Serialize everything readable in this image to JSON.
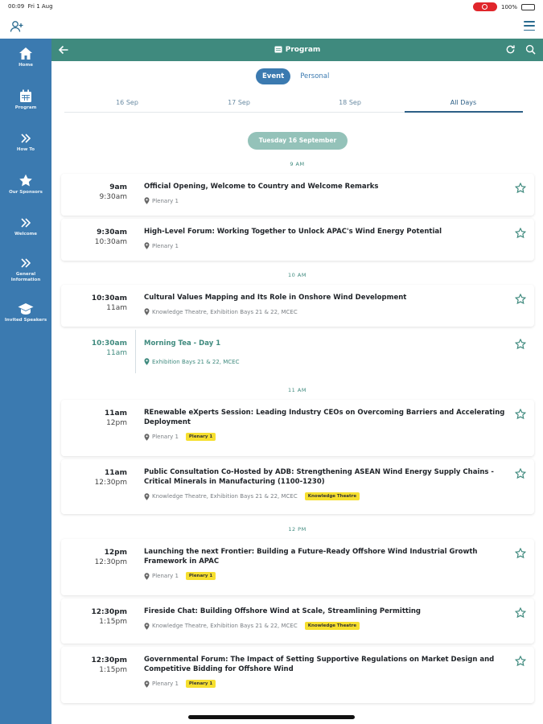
{
  "status": {
    "time": "00:09",
    "date": "Fri 1 Aug",
    "battery": "100%"
  },
  "colors": {
    "sidebar": "#3b7ab0",
    "header": "#3f8a7e",
    "accent": "#3f8a7e",
    "tag": "#f6df2f"
  },
  "sidebar": {
    "items": [
      {
        "label": "Home",
        "icon": "home-icon"
      },
      {
        "label": "Program",
        "icon": "calendar-icon"
      },
      {
        "label": "How To",
        "icon": "chevrons-icon"
      },
      {
        "label": "Our Sponsors",
        "icon": "star-icon"
      },
      {
        "label": "Welcome",
        "icon": "chevrons-icon"
      },
      {
        "label": "General Information",
        "icon": "chevrons-icon"
      },
      {
        "label": "Invited Speakers",
        "icon": "graduation-cap-icon"
      }
    ]
  },
  "header": {
    "title": "Program"
  },
  "toggle": {
    "event": "Event",
    "personal": "Personal"
  },
  "tabs": [
    "16 Sep",
    "17 Sep",
    "18 Sep",
    "All Days"
  ],
  "day_label": "Tuesday 16 September",
  "hours": {
    "h9": "9 AM",
    "h10": "10 AM",
    "h11": "11 AM",
    "h12": "12 PM"
  },
  "sessions": [
    {
      "start": "9am",
      "end": "9:30am",
      "title": "Official Opening, Welcome to Country and Welcome Remarks",
      "location": "Plenary 1",
      "tag": ""
    },
    {
      "start": "9:30am",
      "end": "10:30am",
      "title": "High-Level Forum: Working Together to Unlock APAC's Wind Energy Potential",
      "location": "Plenary 1",
      "tag": ""
    },
    {
      "start": "10:30am",
      "end": "11am",
      "title": "Cultural Values Mapping and Its Role in Onshore Wind Development",
      "location": "Knowledge Theatre, Exhibition Bays 21 & 22, MCEC",
      "tag": ""
    },
    {
      "start": "10:30am",
      "end": "11am",
      "title": "Morning Tea - Day 1",
      "location": "Exhibition Bays 21 & 22, MCEC",
      "tag": ""
    },
    {
      "start": "11am",
      "end": "12pm",
      "title": "REnewable eXperts Session: Leading Industry CEOs on Overcoming Barriers and Accelerating Deployment",
      "location": "Plenary 1",
      "tag": "Plenary 1"
    },
    {
      "start": "11am",
      "end": "12:30pm",
      "title": "Public Consultation Co-Hosted by ADB: Strengthening ASEAN Wind Energy Supply Chains - Critical Minerals in Manufacturing (1100-1230)",
      "location": "Knowledge Theatre, Exhibition Bays 21 & 22, MCEC",
      "tag": "Knowledge Theatre"
    },
    {
      "start": "12pm",
      "end": "12:30pm",
      "title": "Launching the next Frontier: Building a Future-Ready Offshore Wind Industrial Growth Framework in APAC",
      "location": "Plenary 1",
      "tag": "Plenary 1"
    },
    {
      "start": "12:30pm",
      "end": "1:15pm",
      "title": "Fireside Chat: Building Offshore Wind at Scale, Streamlining Permitting",
      "location": "Knowledge Theatre, Exhibition Bays 21 & 22, MCEC",
      "tag": "Knowledge Theatre"
    },
    {
      "start": "12:30pm",
      "end": "1:15pm",
      "title": "Governmental Forum: The Impact of Setting Supportive Regulations on Market Design and Competitive Bidding for Offshore Wind",
      "location": "Plenary 1",
      "tag": "Plenary 1"
    }
  ]
}
